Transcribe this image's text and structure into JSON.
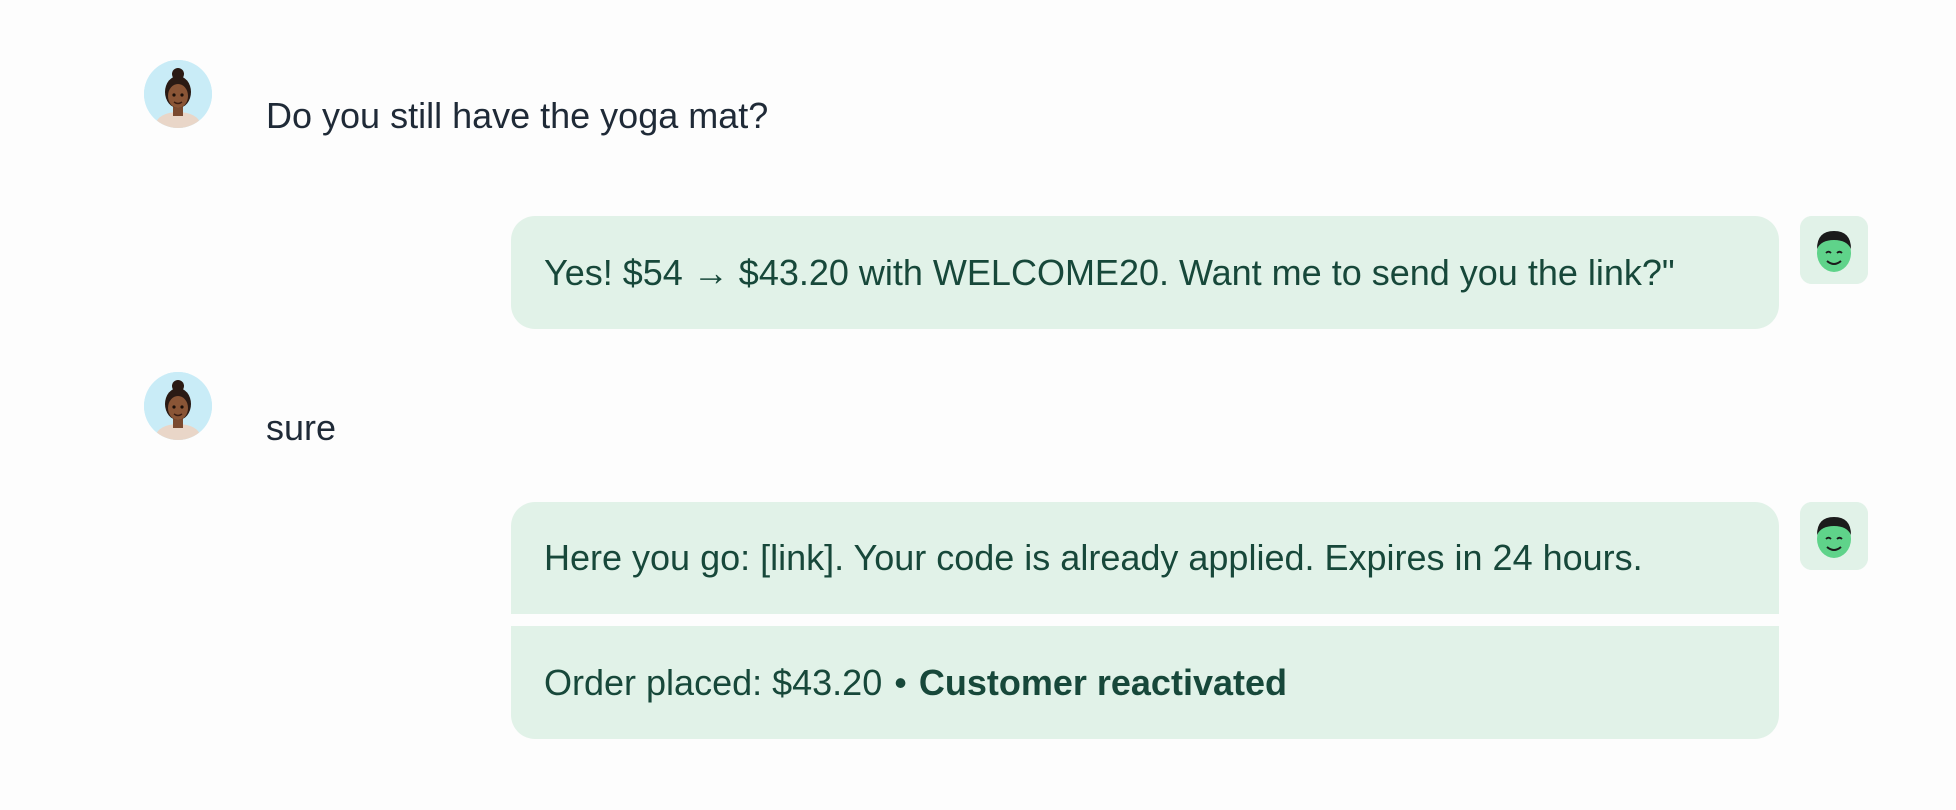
{
  "conversation": {
    "messages": [
      {
        "sender": "user",
        "avatar_icon": "woman-avatar-icon",
        "text": "Do you still have the yoga mat?"
      },
      {
        "sender": "bot",
        "avatar_icon": "smiling-bot-avatar-icon",
        "text": "Yes! $54 → $43.20 with WELCOME20. Want me to send you the link?\""
      },
      {
        "sender": "user",
        "avatar_icon": "woman-avatar-icon",
        "text": "sure"
      },
      {
        "sender": "bot",
        "avatar_icon": "smiling-bot-avatar-icon",
        "text": "Here you go: [link]. Your code is already applied. Expires in 24 hours.",
        "status": {
          "order_text": "Order placed: $43.20",
          "separator": "•",
          "highlight": "Customer reactivated"
        }
      }
    ]
  },
  "colors": {
    "background": "#fdfdfd",
    "bot_bubble": "#e1f2e8",
    "bot_text": "#17483a",
    "user_text": "#1f2a37",
    "user_avatar_bg": "#c9ecf7",
    "bot_avatar_face": "#5fd38a"
  }
}
